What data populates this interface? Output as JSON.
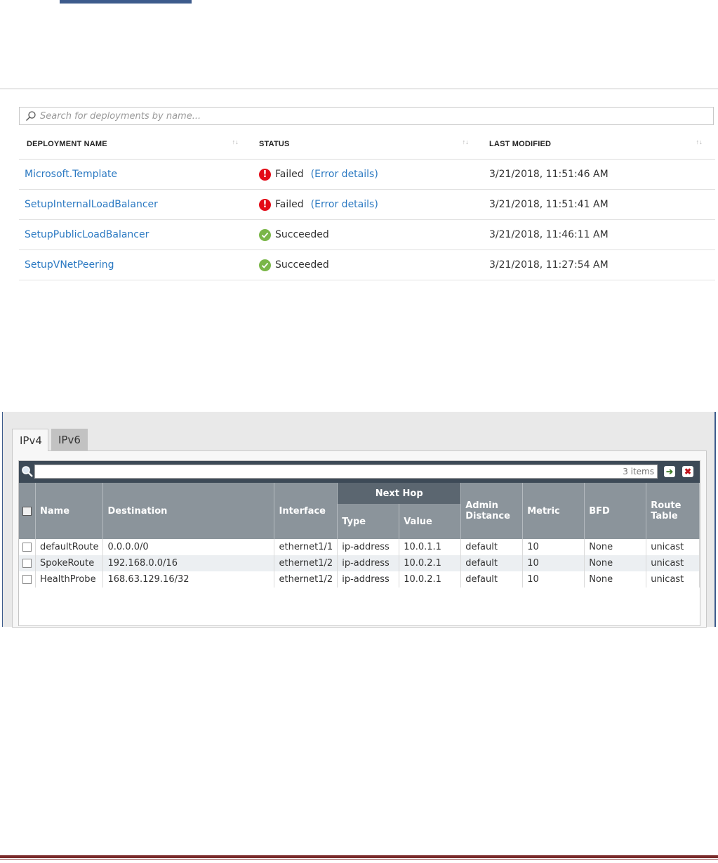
{
  "deployments": {
    "search_placeholder": "Search for deployments by name...",
    "columns": {
      "name": "DEPLOYMENT NAME",
      "status": "STATUS",
      "modified": "LAST MODIFIED"
    },
    "rows": [
      {
        "name": "Microsoft.Template",
        "status": "Failed",
        "error_link": "(Error details)",
        "modified": "3/21/2018, 11:51:46 AM"
      },
      {
        "name": "SetupInternalLoadBalancer",
        "status": "Failed",
        "error_link": "(Error details)",
        "modified": "3/21/2018, 11:51:41 AM"
      },
      {
        "name": "SetupPublicLoadBalancer",
        "status": "Succeeded",
        "modified": "3/21/2018, 11:46:11 AM"
      },
      {
        "name": "SetupVNetPeering",
        "status": "Succeeded",
        "modified": "3/21/2018, 11:27:54 AM"
      }
    ],
    "colors": {
      "link": "#2b79c2",
      "failed": "#e30a17",
      "succeeded": "#7ab648"
    }
  },
  "routes": {
    "tabs": [
      "IPv4",
      "IPv6"
    ],
    "items_count": "3 items",
    "group_header": "Next Hop",
    "columns": {
      "name": "Name",
      "destination": "Destination",
      "interface": "Interface",
      "type": "Type",
      "value": "Value",
      "admin_distance": "Admin Distance",
      "metric": "Metric",
      "bfd": "BFD",
      "route_table": "Route Table"
    },
    "rows": [
      {
        "name": "defaultRoute",
        "destination": "0.0.0.0/0",
        "interface": "ethernet1/1",
        "type": "ip-address",
        "value": "10.0.1.1",
        "admin_distance": "default",
        "metric": "10",
        "bfd": "None",
        "route_table": "unicast"
      },
      {
        "name": "SpokeRoute",
        "destination": "192.168.0.0/16",
        "interface": "ethernet1/2",
        "type": "ip-address",
        "value": "10.0.2.1",
        "admin_distance": "default",
        "metric": "10",
        "bfd": "None",
        "route_table": "unicast"
      },
      {
        "name": "HealthProbe",
        "destination": "168.63.129.16/32",
        "interface": "ethernet1/2",
        "type": "ip-address",
        "value": "10.0.2.1",
        "admin_distance": "default",
        "metric": "10",
        "bfd": "None",
        "route_table": "unicast"
      }
    ]
  }
}
